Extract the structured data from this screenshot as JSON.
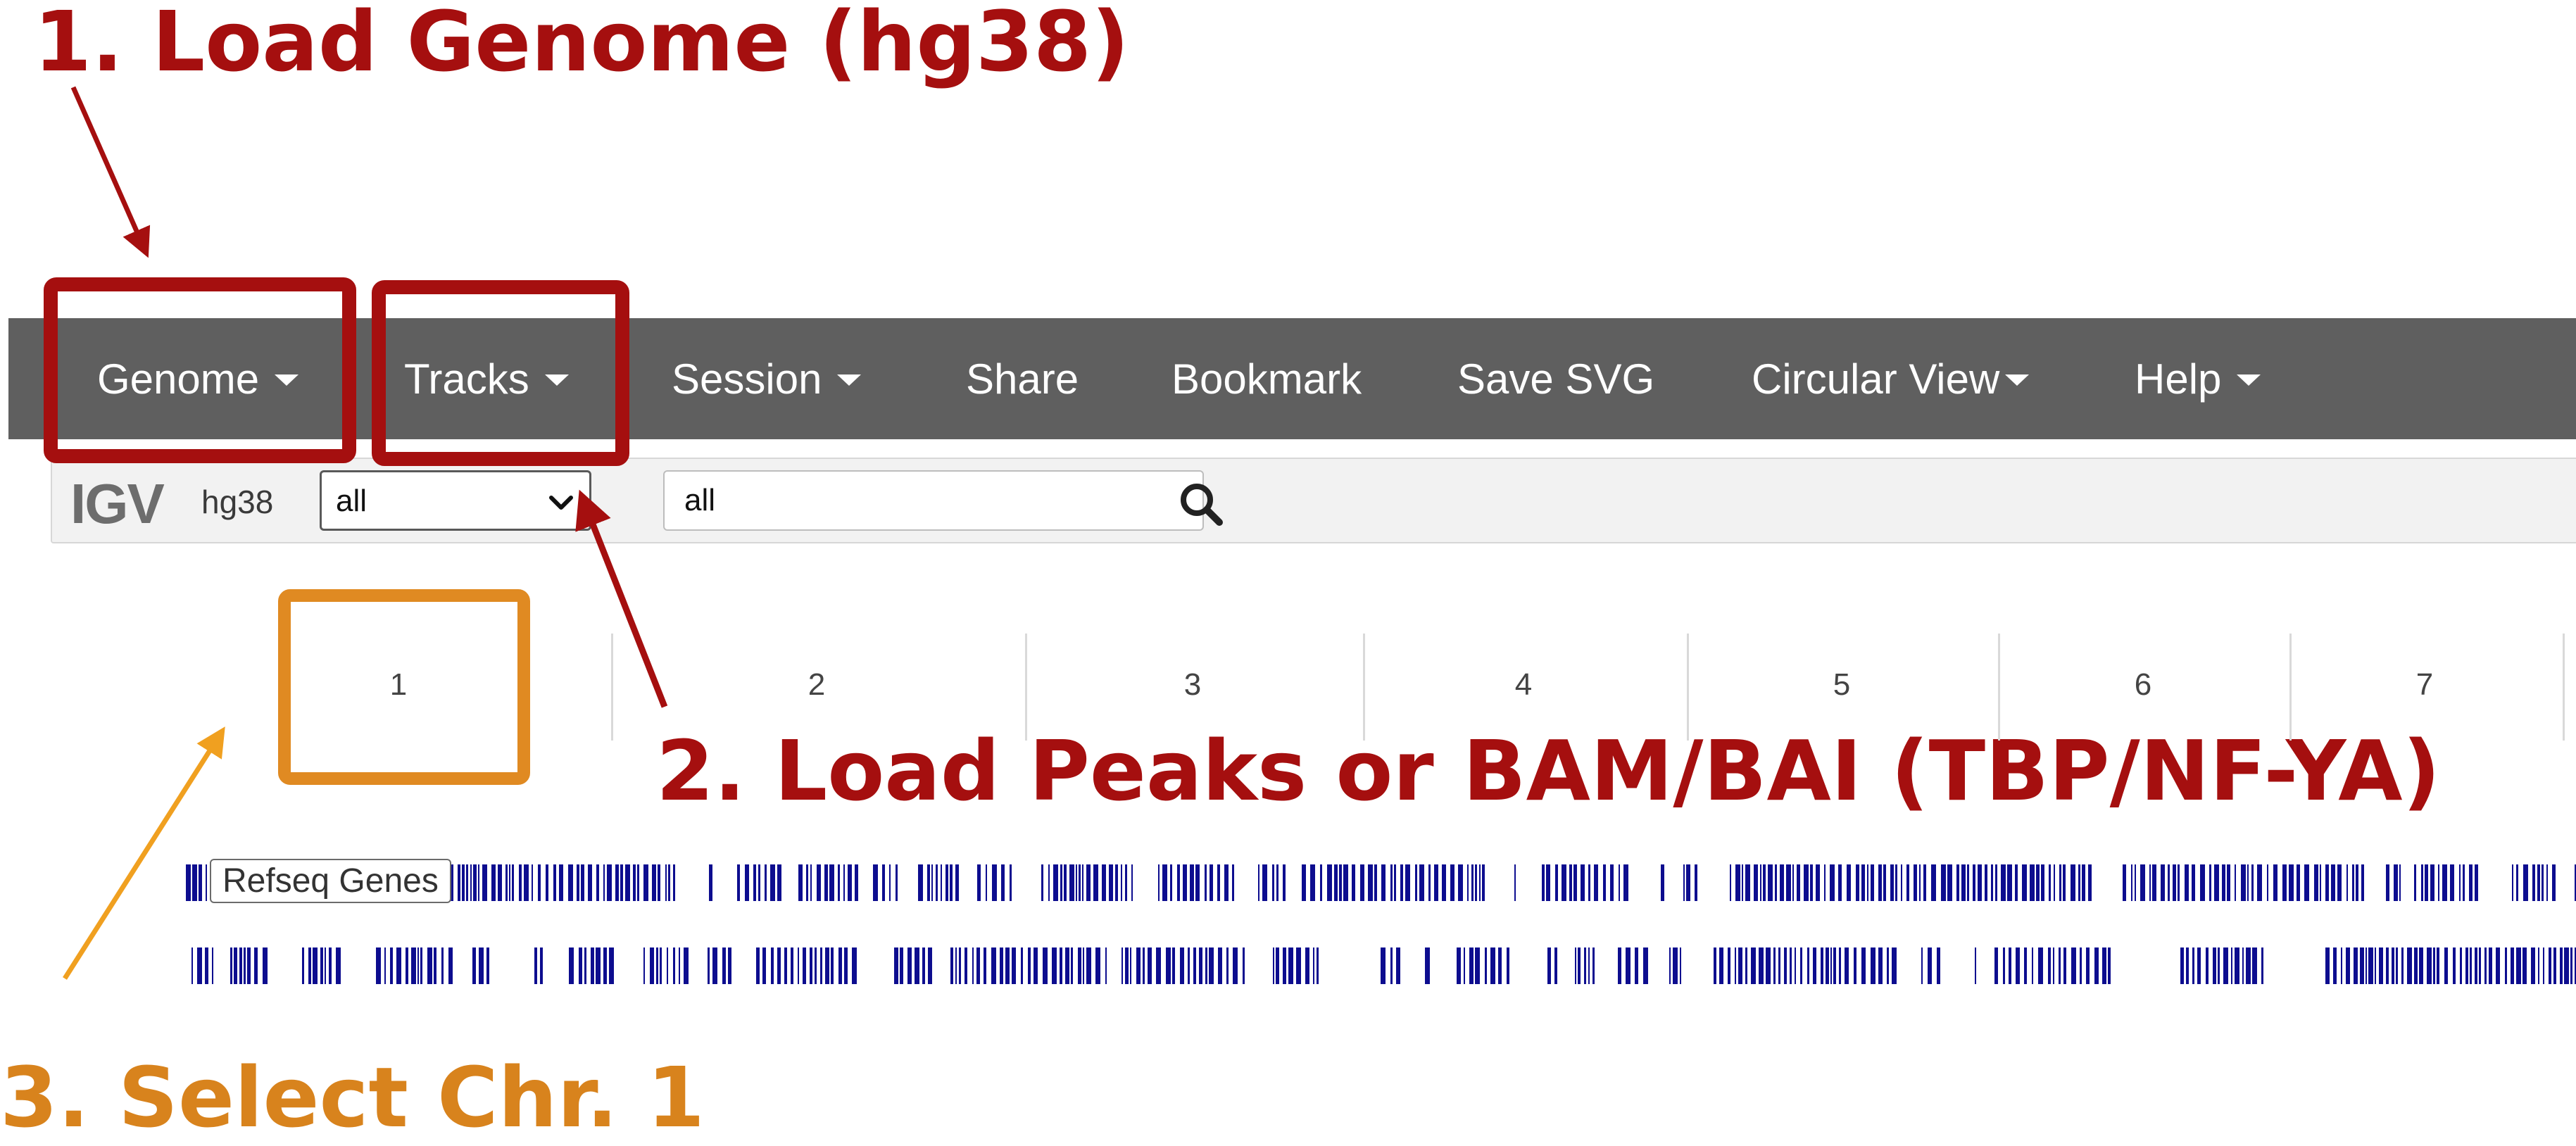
{
  "annotations": {
    "step1": "1. Load Genome (hg38)",
    "step2": "2. Load Peaks or BAM/BAI (TBP/NF-YA)",
    "step3": "3. Select Chr. 1"
  },
  "navbar": {
    "items": [
      {
        "label": "Genome",
        "dropdown": true
      },
      {
        "label": "Tracks",
        "dropdown": true
      },
      {
        "label": "Session",
        "dropdown": true
      },
      {
        "label": "Share",
        "dropdown": false
      },
      {
        "label": "Bookmark",
        "dropdown": false
      },
      {
        "label": "Save SVG",
        "dropdown": false
      },
      {
        "label": "Circular View",
        "dropdown": true
      },
      {
        "label": "Help",
        "dropdown": true
      }
    ]
  },
  "toolbar": {
    "logo": "IGV",
    "genome": "hg38",
    "chromosome_select": "all",
    "locus_input": "all"
  },
  "chromosomes": [
    "1",
    "2",
    "3",
    "4",
    "5",
    "6",
    "7"
  ],
  "tracks": {
    "refseq_label": "Refseq Genes"
  },
  "colors": {
    "navbar": "#5f5f5f",
    "annotation_red": "#a50f0f",
    "annotation_orange": "#e08a22",
    "gene_blue": "#0d0d8f"
  },
  "icons": [
    "caret-down-icon",
    "search-icon",
    "chevron-down-icon"
  ]
}
